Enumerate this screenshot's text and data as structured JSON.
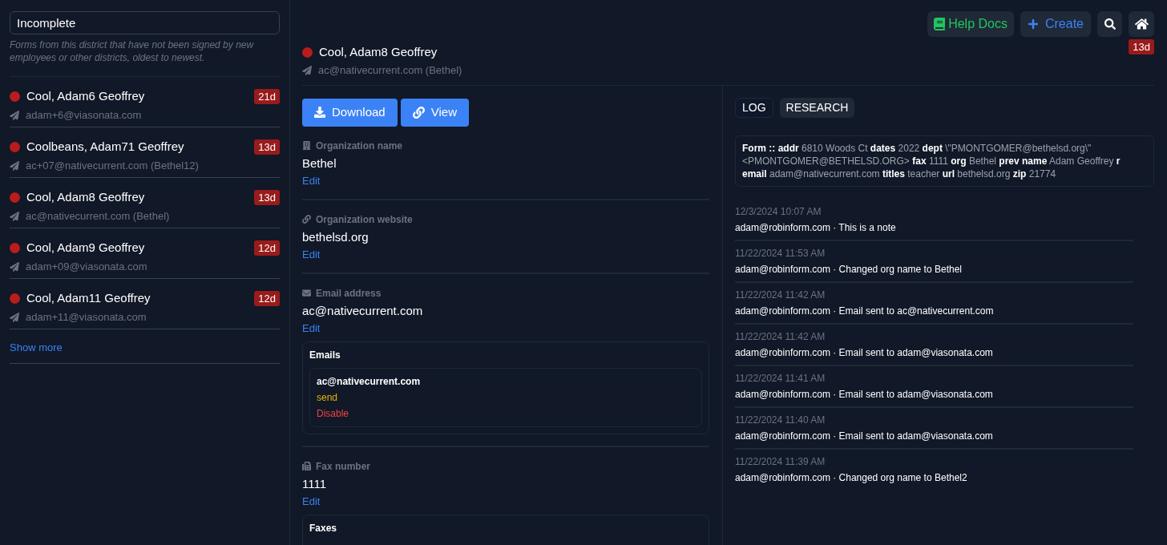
{
  "sidebar": {
    "search": {
      "value": "Incomplete"
    },
    "description": "Forms from this district that have not been signed by new employees or other districts, oldest to newest.",
    "items": [
      {
        "name": "Cool, Adam6 Geoffrey",
        "email": "adam+6@viasonata.com",
        "age": "21d"
      },
      {
        "name": "Coolbeans, Adam71 Geoffrey",
        "email": "ac+07@nativecurrent.com (Bethel12)",
        "age": "13d"
      },
      {
        "name": "Cool, Adam8 Geoffrey",
        "email": "ac@nativecurrent.com (Bethel)",
        "age": "13d"
      },
      {
        "name": "Cool, Adam9 Geoffrey",
        "email": "adam+09@viasonata.com",
        "age": "12d"
      },
      {
        "name": "Cool, Adam11 Geoffrey",
        "email": "adam+11@viasonata.com",
        "age": "12d"
      }
    ],
    "show_more": "Show more"
  },
  "toolbar": {
    "help": "Help Docs",
    "create": "Create"
  },
  "record": {
    "name": "Cool, Adam8 Geoffrey",
    "email": "ac@nativecurrent.com (Bethel)",
    "age": "13d"
  },
  "actions": {
    "download": "Download",
    "view": "View"
  },
  "fields": [
    {
      "kind": "organization",
      "label": "Organization name",
      "value": "Bethel",
      "edit": "Edit"
    },
    {
      "kind": "website",
      "label": "Organization website",
      "value": "bethelsd.org",
      "edit": "Edit"
    },
    {
      "kind": "email",
      "label": "Email address",
      "value": "ac@nativecurrent.com",
      "edit": "Edit",
      "card": {
        "title": "Emails",
        "items": [
          {
            "address": "ac@nativecurrent.com",
            "actions": [
              {
                "kind": "send",
                "label": "send"
              },
              {
                "kind": "disable",
                "label": "Disable"
              }
            ]
          }
        ]
      }
    },
    {
      "kind": "fax",
      "label": "Fax number",
      "value": "1111",
      "edit": "Edit",
      "card": {
        "title": "Faxes"
      }
    }
  ],
  "tabs": [
    {
      "label": "LOG",
      "selected": false
    },
    {
      "label": "RESEARCH",
      "selected": true
    }
  ],
  "research": "**Form :: addr** 6810 Woods Ct **dates** 2022 **dept** \\\"PMONTGOMER@bethelsd.org\\\" <PMONTGOMER@BETHELSD.ORG> **fax** 1111 **org** Bethel **prev name** Adam Geoffrey **r email** adam@nativecurrent.com **titles** teacher **url** bethelsd.org **zip** 21774",
  "log": [
    {
      "time": "12/3/2024 10:07 AM",
      "text": "adam@robinform.com · This is a note"
    },
    {
      "time": "11/22/2024 11:53 AM",
      "text": "adam@robinform.com · Changed org name to Bethel"
    },
    {
      "time": "11/22/2024 11:42 AM",
      "text": "adam@robinform.com · Email sent to ac@nativecurrent.com"
    },
    {
      "time": "11/22/2024 11:42 AM",
      "text": "adam@robinform.com · Email sent to adam@viasonata.com"
    },
    {
      "time": "11/22/2024 11:41 AM",
      "text": "adam@robinform.com · Email sent to adam@viasonata.com"
    },
    {
      "time": "11/22/2024 11:40 AM",
      "text": "adam@robinform.com · Email sent to adam@viasonata.com"
    },
    {
      "time": "11/22/2024 11:39 AM",
      "text": "adam@robinform.com · Changed org name to Bethel2"
    }
  ]
}
